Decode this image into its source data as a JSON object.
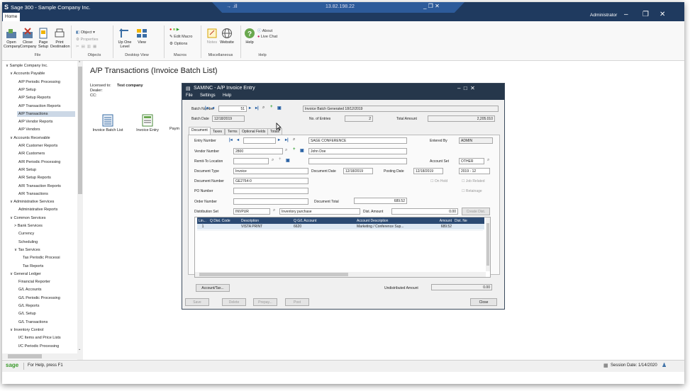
{
  "app": {
    "logo": "S",
    "title": "Sage 300 - Sample Company Inc.",
    "home_tab": "Home",
    "rdp_signal": "→ .ill",
    "rdp_host": "13.82.198.22",
    "rdp_controls": "_ ❐ ✕",
    "user": "Administrator",
    "win_controls": "– ❐ ✕"
  },
  "ribbon": {
    "file": {
      "open_company": "Open\nCompany",
      "close_company": "Close\nCompany",
      "page_setup": "Page\nSetup",
      "print_destination": "Print\nDestination",
      "group": "File"
    },
    "objects": {
      "object": "Object ▾",
      "properties": "Properties",
      "group": "Objects"
    },
    "desktop_view": {
      "up_one_level": "Up One\nLevel",
      "view": "View",
      "group": "Desktop View"
    },
    "macros": {
      "edit_macro": "Edit Macro",
      "options": "Options",
      "group": "Macros"
    },
    "misc": {
      "notes": "Notes",
      "website": "Website",
      "group": "Miscellaneous"
    },
    "help": {
      "help": "Help",
      "about": "About",
      "live_chat": "Live Chat",
      "group": "Help"
    }
  },
  "nav": {
    "items": [
      {
        "label": "∨ Sample Company Inc.",
        "indent": 0
      },
      {
        "label": "∨ Accounts Payable",
        "indent": 1
      },
      {
        "label": "A/P Periodic Processing",
        "indent": 3
      },
      {
        "label": "A/P Setup",
        "indent": 3
      },
      {
        "label": "A/P Setup Reports",
        "indent": 3
      },
      {
        "label": "A/P Transaction Reports",
        "indent": 3
      },
      {
        "label": "A/P Transactions",
        "indent": 3,
        "selected": true
      },
      {
        "label": "A/P Vendor Reports",
        "indent": 3
      },
      {
        "label": "A/P Vendors",
        "indent": 3
      },
      {
        "label": "∨ Accounts Receivable",
        "indent": 1
      },
      {
        "label": "A/R Customer Reports",
        "indent": 3
      },
      {
        "label": "A/R Customers",
        "indent": 3
      },
      {
        "label": "A/R Periodic Processing",
        "indent": 3
      },
      {
        "label": "A/R Setup",
        "indent": 3
      },
      {
        "label": "A/R Setup Reports",
        "indent": 3
      },
      {
        "label": "A/R Transaction Reports",
        "indent": 3
      },
      {
        "label": "A/R Transactions",
        "indent": 3
      },
      {
        "label": "∨ Administrative Services",
        "indent": 1
      },
      {
        "label": "Administrative Reports",
        "indent": 3
      },
      {
        "label": "∨ Common Services",
        "indent": 1
      },
      {
        "label": "> Bank Services",
        "indent": 2
      },
      {
        "label": "Currency",
        "indent": 3
      },
      {
        "label": "Scheduling",
        "indent": 3
      },
      {
        "label": "∨ Tax Services",
        "indent": 2
      },
      {
        "label": "Tax Periodic Processi",
        "indent": 4
      },
      {
        "label": "Tax Reports",
        "indent": 4
      },
      {
        "label": "∨ General Ledger",
        "indent": 1
      },
      {
        "label": "Financial Reporter",
        "indent": 3
      },
      {
        "label": "G/L Accounts",
        "indent": 3
      },
      {
        "label": "G/L Periodic Processing",
        "indent": 3
      },
      {
        "label": "G/L Reports",
        "indent": 3
      },
      {
        "label": "G/L Setup",
        "indent": 3
      },
      {
        "label": "G/L Transactions",
        "indent": 3
      },
      {
        "label": "∨ Inventory Control",
        "indent": 1
      },
      {
        "label": "I/C Items and Price Lists",
        "indent": 3
      },
      {
        "label": "I/C Periodic Processing",
        "indent": 3
      }
    ]
  },
  "content": {
    "page_title": "A/P Transactions (Invoice Batch List)",
    "licensed_label": "Licensed to:",
    "licensed_value": "Test company",
    "dealer_label": "Dealer:",
    "cc_label": "CC:",
    "icons": [
      "Invoice Batch List",
      "Invoice Entry",
      "Paym"
    ]
  },
  "dialog": {
    "title": "SAMINC - A/P Invoice Entry",
    "menu": [
      "File",
      "Settings",
      "Help"
    ],
    "batch_number_label": "Batch Number",
    "batch_number": "51",
    "batch_desc": "Invoice Batch Generated 18/12/2019",
    "batch_date_label": "Batch Date",
    "batch_date": "12/18/2019",
    "entries_label": "No. of Entries",
    "entries": "2",
    "total_amount_label": "Total Amount",
    "total_amount": "2,205.010",
    "tabs": [
      "Document",
      "Taxes",
      "Terms",
      "Optional Fields",
      "Totals"
    ],
    "entry_number_label": "Entry Number",
    "entry_desc": "SAGE CONFERENCE",
    "entered_by_label": "Entered By",
    "entered_by": "ADMIN",
    "vendor_number_label": "Vendor Number",
    "vendor_number": "2800",
    "vendor_name": "John Doe",
    "remit_to_label": "Remit-To Location",
    "account_set_label": "Account Set",
    "account_set": "OTHER",
    "document_type_label": "Document Type",
    "document_type": "Invoice",
    "document_date_label": "Document Date",
    "document_date": "12/18/2019",
    "posting_date_label": "Posting Date",
    "posting_date": "12/18/2019",
    "fiscal_period": "2019 - 12",
    "document_number_label": "Document Number",
    "document_number": "GE2764-0",
    "on_hold_label": "On Hold",
    "job_related_label": "Job Related",
    "po_number_label": "PO Number",
    "retainage_label": "Retainage",
    "order_number_label": "Order Number",
    "document_total_label": "Document Total",
    "document_total": "689.52",
    "dist_set_label": "Distribution Set",
    "dist_set": "INVPUR",
    "dist_set_desc": "Inventory purchase",
    "dist_amount_label": "Dist. Amount",
    "dist_amount": "0.00",
    "create_dist": "Create Dist.",
    "grid": {
      "headers": [
        "Lin...",
        "Q  Dist. Code",
        "Description",
        "Q  G/L Account",
        "Account Description",
        "Amount",
        "Dist. Ne"
      ],
      "row": [
        "1",
        "",
        "VISTA PRINT",
        "6620",
        "Marketing / Conference Sup...",
        "689.52",
        ""
      ]
    },
    "account_tax_btn": "Account/Tax...",
    "undistributed_label": "Undistributed Amount",
    "undistributed": "0.00",
    "buttons": [
      "Save",
      "Delete",
      "Prepay...",
      "Post"
    ],
    "close": "Close",
    "win_controls": "–  □  ✕"
  },
  "statusbar": {
    "logo": "sage",
    "help": "For Help, press F1",
    "session_date": "Session Date: 1/14/2020"
  }
}
